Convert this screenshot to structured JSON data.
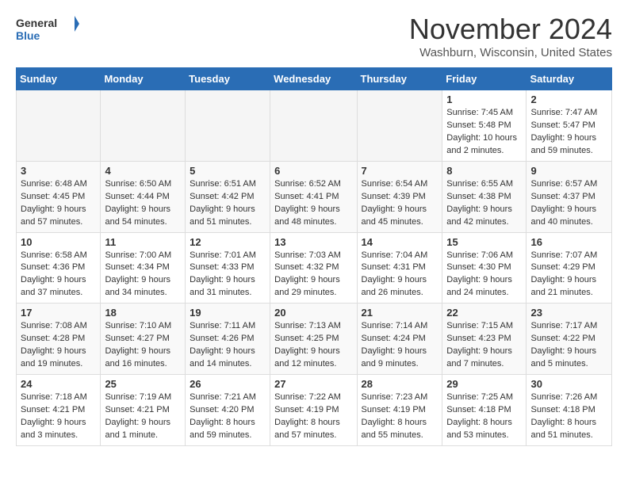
{
  "logo": {
    "general": "General",
    "blue": "Blue"
  },
  "title": "November 2024",
  "location": "Washburn, Wisconsin, United States",
  "days_of_week": [
    "Sunday",
    "Monday",
    "Tuesday",
    "Wednesday",
    "Thursday",
    "Friday",
    "Saturday"
  ],
  "weeks": [
    [
      {
        "day": "",
        "empty": true
      },
      {
        "day": "",
        "empty": true
      },
      {
        "day": "",
        "empty": true
      },
      {
        "day": "",
        "empty": true
      },
      {
        "day": "",
        "empty": true
      },
      {
        "day": "1",
        "sunrise": "7:45 AM",
        "sunset": "5:48 PM",
        "daylight": "10 hours and 2 minutes."
      },
      {
        "day": "2",
        "sunrise": "7:47 AM",
        "sunset": "5:47 PM",
        "daylight": "9 hours and 59 minutes."
      }
    ],
    [
      {
        "day": "3",
        "sunrise": "6:48 AM",
        "sunset": "4:45 PM",
        "daylight": "9 hours and 57 minutes."
      },
      {
        "day": "4",
        "sunrise": "6:50 AM",
        "sunset": "4:44 PM",
        "daylight": "9 hours and 54 minutes."
      },
      {
        "day": "5",
        "sunrise": "6:51 AM",
        "sunset": "4:42 PM",
        "daylight": "9 hours and 51 minutes."
      },
      {
        "day": "6",
        "sunrise": "6:52 AM",
        "sunset": "4:41 PM",
        "daylight": "9 hours and 48 minutes."
      },
      {
        "day": "7",
        "sunrise": "6:54 AM",
        "sunset": "4:39 PM",
        "daylight": "9 hours and 45 minutes."
      },
      {
        "day": "8",
        "sunrise": "6:55 AM",
        "sunset": "4:38 PM",
        "daylight": "9 hours and 42 minutes."
      },
      {
        "day": "9",
        "sunrise": "6:57 AM",
        "sunset": "4:37 PM",
        "daylight": "9 hours and 40 minutes."
      }
    ],
    [
      {
        "day": "10",
        "sunrise": "6:58 AM",
        "sunset": "4:36 PM",
        "daylight": "9 hours and 37 minutes."
      },
      {
        "day": "11",
        "sunrise": "7:00 AM",
        "sunset": "4:34 PM",
        "daylight": "9 hours and 34 minutes."
      },
      {
        "day": "12",
        "sunrise": "7:01 AM",
        "sunset": "4:33 PM",
        "daylight": "9 hours and 31 minutes."
      },
      {
        "day": "13",
        "sunrise": "7:03 AM",
        "sunset": "4:32 PM",
        "daylight": "9 hours and 29 minutes."
      },
      {
        "day": "14",
        "sunrise": "7:04 AM",
        "sunset": "4:31 PM",
        "daylight": "9 hours and 26 minutes."
      },
      {
        "day": "15",
        "sunrise": "7:06 AM",
        "sunset": "4:30 PM",
        "daylight": "9 hours and 24 minutes."
      },
      {
        "day": "16",
        "sunrise": "7:07 AM",
        "sunset": "4:29 PM",
        "daylight": "9 hours and 21 minutes."
      }
    ],
    [
      {
        "day": "17",
        "sunrise": "7:08 AM",
        "sunset": "4:28 PM",
        "daylight": "9 hours and 19 minutes."
      },
      {
        "day": "18",
        "sunrise": "7:10 AM",
        "sunset": "4:27 PM",
        "daylight": "9 hours and 16 minutes."
      },
      {
        "day": "19",
        "sunrise": "7:11 AM",
        "sunset": "4:26 PM",
        "daylight": "9 hours and 14 minutes."
      },
      {
        "day": "20",
        "sunrise": "7:13 AM",
        "sunset": "4:25 PM",
        "daylight": "9 hours and 12 minutes."
      },
      {
        "day": "21",
        "sunrise": "7:14 AM",
        "sunset": "4:24 PM",
        "daylight": "9 hours and 9 minutes."
      },
      {
        "day": "22",
        "sunrise": "7:15 AM",
        "sunset": "4:23 PM",
        "daylight": "9 hours and 7 minutes."
      },
      {
        "day": "23",
        "sunrise": "7:17 AM",
        "sunset": "4:22 PM",
        "daylight": "9 hours and 5 minutes."
      }
    ],
    [
      {
        "day": "24",
        "sunrise": "7:18 AM",
        "sunset": "4:21 PM",
        "daylight": "9 hours and 3 minutes."
      },
      {
        "day": "25",
        "sunrise": "7:19 AM",
        "sunset": "4:21 PM",
        "daylight": "9 hours and 1 minute."
      },
      {
        "day": "26",
        "sunrise": "7:21 AM",
        "sunset": "4:20 PM",
        "daylight": "8 hours and 59 minutes."
      },
      {
        "day": "27",
        "sunrise": "7:22 AM",
        "sunset": "4:19 PM",
        "daylight": "8 hours and 57 minutes."
      },
      {
        "day": "28",
        "sunrise": "7:23 AM",
        "sunset": "4:19 PM",
        "daylight": "8 hours and 55 minutes."
      },
      {
        "day": "29",
        "sunrise": "7:25 AM",
        "sunset": "4:18 PM",
        "daylight": "8 hours and 53 minutes."
      },
      {
        "day": "30",
        "sunrise": "7:26 AM",
        "sunset": "4:18 PM",
        "daylight": "8 hours and 51 minutes."
      }
    ]
  ]
}
